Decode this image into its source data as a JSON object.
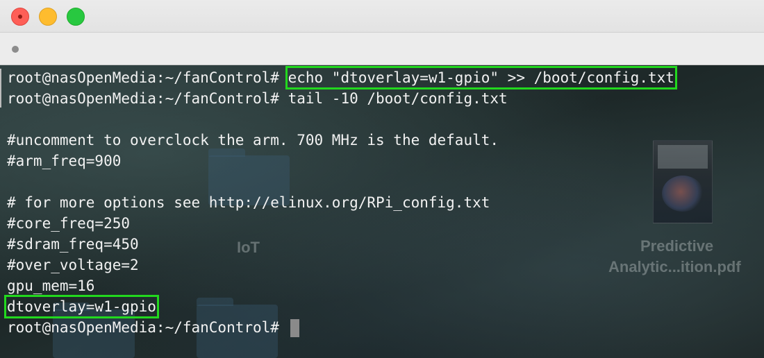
{
  "window": {
    "controls": [
      "close-icon",
      "minimize-icon",
      "zoom-icon"
    ],
    "colors": {
      "close": "#fe5f57",
      "minimize": "#febc2e",
      "zoom": "#28c840",
      "highlight": "#22d81e"
    }
  },
  "desktop": {
    "folder_label": "IoT",
    "pdf_label_1": "Predictive",
    "pdf_label_2": "Analytic...ition.pdf"
  },
  "terminal": {
    "prompt": "root@nasOpenMedia:~/fanControl#",
    "cmd1": "echo \"dtoverlay=w1-gpio\" >> /boot/config.txt",
    "cmd2": "tail -10 /boot/config.txt",
    "out1": "#uncomment to overclock the arm. 700 MHz is the default.",
    "out2": "#arm_freq=900",
    "out3": "# for more options see http://elinux.org/RPi_config.txt",
    "out4": "#core_freq=250",
    "out5": "#sdram_freq=450",
    "out6": "#over_voltage=2",
    "out7": "gpu_mem=16",
    "out8": "dtoverlay=w1-gpio"
  }
}
